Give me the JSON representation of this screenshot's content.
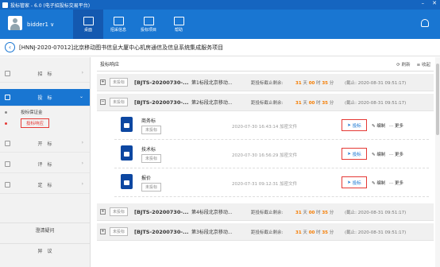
{
  "window": {
    "title": "投标管家 - 6.0 (电子招投标交易平台)",
    "controls": [
      "–",
      "✕"
    ]
  },
  "header": {
    "username": "bidder1 ∨",
    "nav": [
      {
        "label": "桌面",
        "icon": "desktop-icon",
        "active": true
      },
      {
        "label": "招采信息",
        "icon": "search-doc-icon",
        "active": false
      },
      {
        "label": "投标项目",
        "icon": "project-icon",
        "active": false
      },
      {
        "label": "帮助",
        "icon": "help-icon",
        "active": false
      }
    ]
  },
  "project": {
    "back": "‹",
    "title": "[HNNJ-2020-07012]北京移动图书信息大厦中心机房通信及信息系统集成服务项目"
  },
  "sidebar": {
    "items": [
      {
        "label": "招　标"
      },
      {
        "label": "投　标",
        "active": true
      },
      {
        "label": "开　标"
      },
      {
        "label": "评　标"
      },
      {
        "label": "定　标"
      }
    ],
    "subitems": [
      {
        "label": "投标保证金"
      },
      {
        "label": "投标响应",
        "active": true
      }
    ],
    "bottom": [
      "澄清疑问",
      "异　议"
    ]
  },
  "main": {
    "tab": "投标响应",
    "refresh": "刷新",
    "collapse_all": "收起",
    "rows": [
      {
        "status": "未投标",
        "code": "[BJTS-20200730-...",
        "pkg": "第1标段北京移动...",
        "deadline_label": "距投标截止剩余:",
        "days": "31",
        "day_unit": "天",
        "hours": "00",
        "hour_unit": "时",
        "mins": "35",
        "min_unit": "分",
        "deadline": "(截止: 2020-08-31 09:51:17)",
        "expand": "+"
      },
      {
        "status": "未投标",
        "code": "[BJTS-20200730-...",
        "pkg": "第2标段北京移动...",
        "deadline_label": "距投标截止剩余:",
        "days": "31",
        "day_unit": "天",
        "hours": "00",
        "hour_unit": "时",
        "mins": "35",
        "min_unit": "分",
        "deadline": "(截止: 2020-08-31 09:51:17)",
        "expand": "−"
      },
      {
        "status": "未投标",
        "code": "[BJTS-20200730-...",
        "pkg": "第4标段北京移动...",
        "deadline_label": "距投标截止剩余:",
        "days": "31",
        "day_unit": "天",
        "hours": "00",
        "hour_unit": "时",
        "mins": "35",
        "min_unit": "分",
        "deadline": "(截止: 2020-08-31 09:51:17)",
        "expand": "+"
      },
      {
        "status": "未投标",
        "code": "[BJTS-20200730-...",
        "pkg": "第3标段北京移动...",
        "deadline_label": "距投标截止剩余:",
        "days": "31",
        "day_unit": "天",
        "hours": "00",
        "hour_unit": "时",
        "mins": "35",
        "min_unit": "分",
        "deadline": "(截止: 2020-08-31 09:51:17)",
        "expand": "+"
      }
    ],
    "cards": [
      {
        "name": "商务标",
        "status": "未投标",
        "time": "2020-07-30 16:43:14 加密文件",
        "bid": "投标",
        "edit": "编制",
        "more": "更多"
      },
      {
        "name": "技术标",
        "status": "未投标",
        "time": "2020-07-30 16:56:29 加密文件",
        "bid": "投标",
        "edit": "编制",
        "more": "更多"
      },
      {
        "name": "报价",
        "status": "未投标",
        "time": "2020-07-31 09:12:31 加密文件",
        "bid": "投标",
        "edit": "编制",
        "more": "更多"
      }
    ]
  }
}
